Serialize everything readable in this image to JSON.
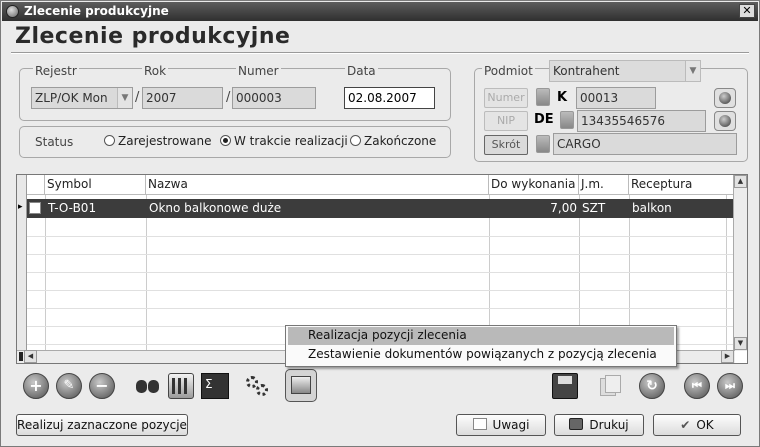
{
  "window": {
    "title": "Zlecenie produkcyjne",
    "close_glyph": "✕"
  },
  "heading": "Zlecenie produkcyjne",
  "doc": {
    "rejestr_label": "Rejestr",
    "rok_label": "Rok",
    "numer_label": "Numer",
    "data_label": "Data",
    "rejestr_value": "ZLP/OK Mon",
    "rok_value": "2007",
    "numer_value": "000003",
    "data_value": "02.08.2007",
    "separator": "/"
  },
  "status": {
    "label": "Status",
    "options": [
      "Zarejestrowane",
      "W trakcie realizacji",
      "Zakończone"
    ],
    "selected_index": 1
  },
  "podmiot": {
    "label": "Podmiot",
    "type_value": "Kontrahent",
    "numer_button": "Numer",
    "nip_button": "NIP",
    "skrot_button": "Skrót",
    "k_prefix": "K",
    "numer_value": "00013",
    "nip_prefix": "DE",
    "nip_value": "13435546576",
    "skrot_value": "CARGO"
  },
  "table": {
    "columns": [
      "Symbol",
      "Nazwa",
      "Do wykonania",
      "J.m.",
      "Receptura"
    ],
    "rows": [
      {
        "symbol": "T-O-B01",
        "nazwa": "Okno balkonowe duże",
        "do_wykonania": "7,00",
        "jm": "SZT",
        "receptura": "balkon"
      }
    ],
    "row_marker": "▸"
  },
  "context_menu": {
    "items": [
      "Realizacja pozycji zlecenia",
      "Zestawienie dokumentów powiązanych z pozycją zlecenia"
    ]
  },
  "toolbar": {
    "icons": [
      "add-icon",
      "edit-icon",
      "delete-icon",
      "binoculars-icon",
      "calculator-icon",
      "sum-icon",
      "gears-icon",
      "document-image-icon",
      "save-icon",
      "copy-icon",
      "refresh-icon",
      "previous-icon",
      "next-icon"
    ]
  },
  "buttons": {
    "realizuj": "Realizuj zaznaczone pozycje",
    "uwagi": "Uwagi",
    "drukuj": "Drukuj",
    "ok": "OK"
  }
}
